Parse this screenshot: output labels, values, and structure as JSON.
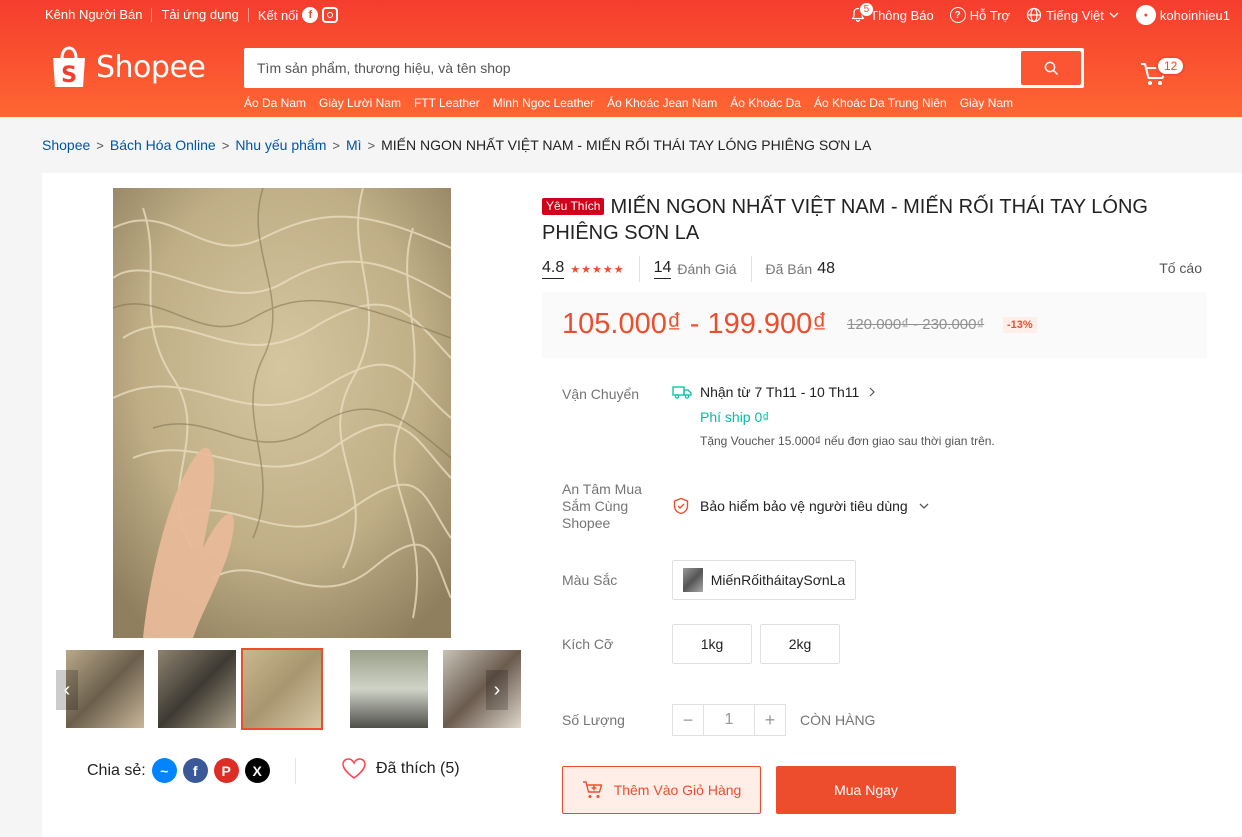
{
  "topbar": {
    "seller_center": "Kênh Người Bán",
    "download_app": "Tải ứng dụng",
    "connect": "Kết nối",
    "notifications": "Thông Báo",
    "notifications_count": "5",
    "help": "Hỗ Trợ",
    "language": "Tiếng Việt",
    "username": "kohoinhieu1"
  },
  "logo": {
    "text": "Shopee"
  },
  "search": {
    "placeholder": "Tìm sản phẩm, thương hiệu, và tên shop",
    "suggestions": [
      "Áo Da Nam",
      "Giày Lười Nam",
      "FTT Leather",
      "Minh Ngoc Leather",
      "Áo Khoác Jean Nam",
      "Áo Khoác Da",
      "Áo Khoác Da Trung Niên",
      "Giày Nam"
    ]
  },
  "cart": {
    "count": "12"
  },
  "breadcrumb": [
    "Shopee",
    "Bách Hóa Online",
    "Nhu yếu phẩm",
    "Mì",
    "MIẾN NGON NHẤT VIỆT NAM - MIẾN RỐI THÁI TAY LÓNG PHIÊNG SƠN LA"
  ],
  "product": {
    "badge": "Yêu Thích",
    "title": "MIẾN NGON NHẤT VIỆT NAM - MIẾN RỐI THÁI TAY LÓNG PHIÊNG SƠN LA",
    "rating": "4.8",
    "rating_stars": 5,
    "reviews_count": "14",
    "reviews_label": "Đánh Giá",
    "sold_label": "Đã Bán",
    "sold_count": "48",
    "report": "Tố cáo",
    "price": "105.000₫ - 199.900₫",
    "original_price": "120.000₫ - 230.000₫",
    "discount": "-13%"
  },
  "shipping": {
    "label": "Vận Chuyển",
    "receive": "Nhận từ 7 Th11 - 10 Th11",
    "fee": "Phí ship 0₫",
    "note": "Tặng Voucher 15.000₫ nếu đơn giao sau thời gian trên."
  },
  "guarantee": {
    "label": "An Tâm Mua Sắm Cùng Shopee",
    "text": "Bảo hiểm bảo vệ người tiêu dùng"
  },
  "color": {
    "label": "Màu Sắc",
    "option": "MiếnRốitháitaySơnLa"
  },
  "size": {
    "label": "Kích Cỡ",
    "options": [
      "1kg",
      "2kg"
    ]
  },
  "quantity": {
    "label": "Số Lượng",
    "value": "1",
    "minus": "−",
    "plus": "+",
    "stock": "CÒN HÀNG"
  },
  "actions": {
    "add_to_cart": "Thêm Vào Giỏ Hàng",
    "buy_now": "Mua Ngay"
  },
  "share": {
    "label": "Chia sẻ:",
    "liked": "Đã thích (5)"
  },
  "colors": {
    "brand": "#ee4d2d",
    "link": "#0055aa",
    "ship_fee": "#00bfa5"
  }
}
